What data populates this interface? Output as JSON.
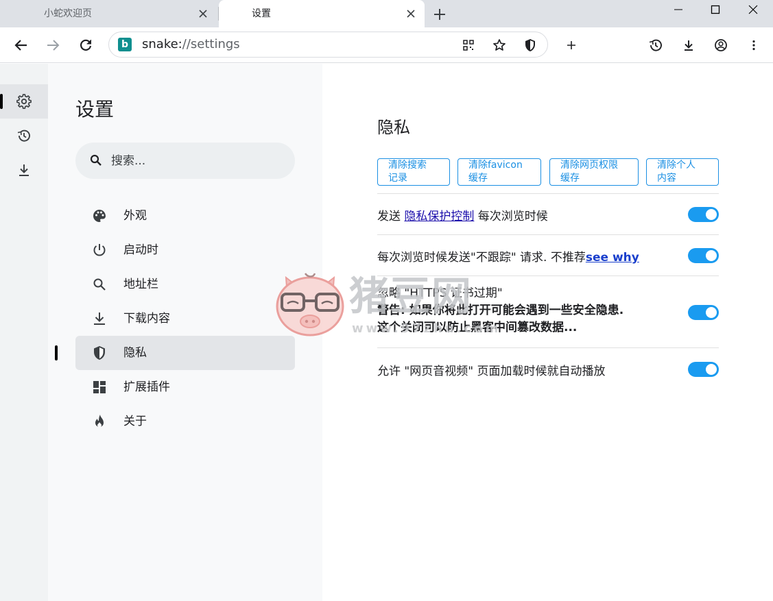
{
  "tabs": [
    {
      "title": "小蛇欢迎页",
      "active": false
    },
    {
      "title": "设置",
      "active": true
    }
  ],
  "omnibox": {
    "scheme": "snake:",
    "rest": "//settings",
    "favicon_letter": "b"
  },
  "rail": {
    "items": [
      "gear-icon",
      "history-icon",
      "download-icon"
    ]
  },
  "nav": {
    "title": "设置",
    "search_placeholder": "搜索...",
    "items": [
      {
        "label": "外观",
        "icon": "palette-icon"
      },
      {
        "label": "启动时",
        "icon": "power-icon"
      },
      {
        "label": "地址栏",
        "icon": "search-icon"
      },
      {
        "label": "下载内容",
        "icon": "download-icon"
      },
      {
        "label": "隐私",
        "icon": "shield-icon",
        "selected": true
      },
      {
        "label": "扩展插件",
        "icon": "extensions-icon"
      },
      {
        "label": "关于",
        "icon": "flame-icon"
      }
    ]
  },
  "privacy": {
    "title": "隐私",
    "buttons": [
      {
        "line1": "清除搜索",
        "line2": "记录"
      },
      {
        "line1": "清除favicon",
        "line2": "缓存"
      },
      {
        "line1": "清除网页权限",
        "line2": "缓存"
      },
      {
        "line1": "清除个人",
        "line2": "内容"
      }
    ],
    "rows": [
      {
        "pre": "发送 ",
        "link": "隐私保护控制",
        "post": " 每次浏览时候",
        "enabled": true
      },
      {
        "pre": "每次浏览时候发送\"不跟踪\" 请求. 不推荐",
        "link": "see why",
        "enabled": true
      },
      {
        "label": "忽略 \"HTTPS 证书过期\"",
        "warning1": "警告: 如果你将此打开可能会遇到一些安全隐患.",
        "warning2": "这个关闭可以防止黑客中间篡改数据...",
        "enabled": true
      },
      {
        "label": "允许 \"网页音视频\" 页面加载时候就自动播放",
        "enabled": true
      }
    ]
  },
  "watermark": {
    "text": "猪豆网",
    "sub": "www.97zhu.com"
  },
  "colors": {
    "accent": "#1a9bf0",
    "button_border": "#1a8fe3"
  }
}
